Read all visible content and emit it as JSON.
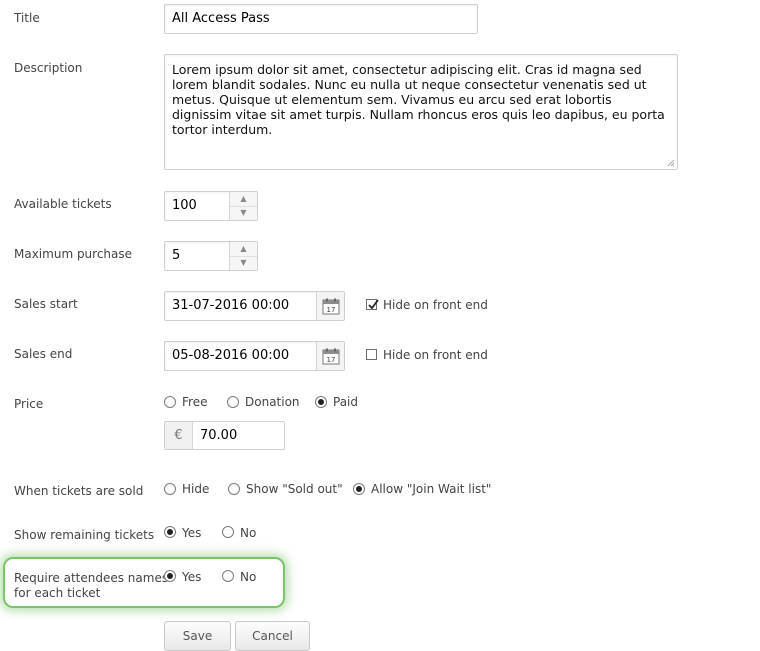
{
  "fields": {
    "title": {
      "label": "Title",
      "value": "All Access Pass"
    },
    "description": {
      "label": "Description",
      "value": "Lorem ipsum dolor sit amet, consectetur adipiscing elit. Cras id magna sed lorem blandit sodales. Nunc eu nulla ut neque consectetur venenatis sed ut metus. Quisque ut elementum sem. Vivamus eu arcu sed erat lobortis dignissim vitae sit amet turpis. Nullam rhoncus eros quis leo dapibus, eu porta tortor interdum."
    },
    "available_tickets": {
      "label": "Available tickets",
      "value": "100"
    },
    "maximum_purchase": {
      "label": "Maximum purchase",
      "value": "5"
    },
    "sales_start": {
      "label": "Sales start",
      "value": "31-07-2016 00:00",
      "hide_label": "Hide on front end",
      "hide_checked": true
    },
    "sales_end": {
      "label": "Sales end",
      "value": "05-08-2016 00:00",
      "hide_label": "Hide on front end",
      "hide_checked": false
    },
    "price": {
      "label": "Price",
      "options": [
        "Free",
        "Donation",
        "Paid"
      ],
      "selected": "Paid",
      "currency_symbol": "€",
      "amount": "70.00"
    },
    "when_sold": {
      "label": "When tickets are sold",
      "options": [
        "Hide",
        "Show \"Sold out\"",
        "Allow \"Join Wait list\""
      ],
      "selected": "Allow \"Join Wait list\""
    },
    "show_remaining": {
      "label": "Show remaining tickets",
      "options": [
        "Yes",
        "No"
      ],
      "selected": "Yes"
    },
    "require_names": {
      "label_line1": "Require attendees names",
      "label_line2": "for each ticket",
      "options": [
        "Yes",
        "No"
      ],
      "selected": "Yes"
    }
  },
  "buttons": {
    "save": "Save",
    "cancel": "Cancel"
  },
  "icons": {
    "spinner_up": "arrow-up-icon",
    "spinner_down": "arrow-down-icon",
    "calendar": "calendar-icon",
    "checkmark": "checkmark-icon",
    "calendar_day": "17"
  },
  "colors": {
    "highlight": "#7cc46a"
  }
}
